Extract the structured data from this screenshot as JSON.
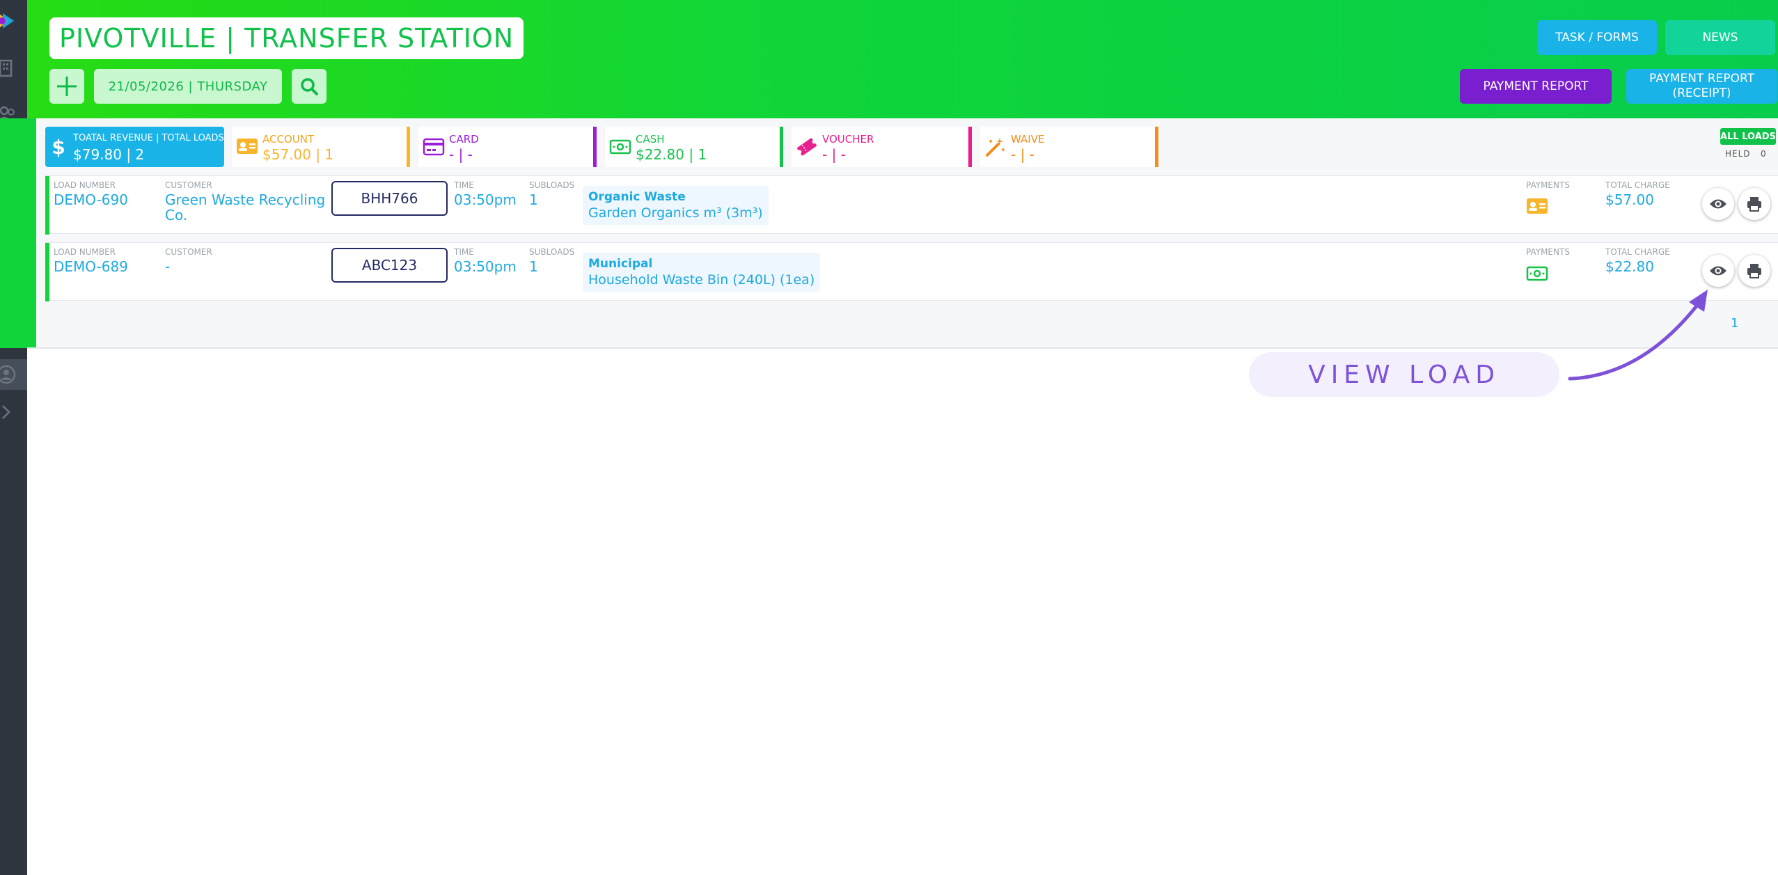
{
  "header": {
    "title": "PIVOTVILLE | TRANSFER STATION",
    "date": "21/05/2026 | THURSDAY",
    "buttons": {
      "task_forms": "TASK / FORMS",
      "news": "NEWS",
      "payment_report": "PAYMENT REPORT",
      "payment_report_receipt": "PAYMENT REPORT\n(RECEIPT)"
    }
  },
  "stats": {
    "total": {
      "label": "TOATAL REVENUE | TOTAL LOADS",
      "value": "$79.80 | 2"
    },
    "account": {
      "label": "ACCOUNT",
      "value": "$57.00 | 1"
    },
    "card": {
      "label": "CARD",
      "value": "- | -"
    },
    "cash": {
      "label": "CASH",
      "value": "$22.80 | 1"
    },
    "voucher": {
      "label": "VOUCHER",
      "value": "- | -"
    },
    "waive": {
      "label": "WAIVE",
      "value": "- | -"
    }
  },
  "filters": {
    "all_loads": "ALL LOADS",
    "held": "HELD",
    "held_count": "0"
  },
  "columns": {
    "load_number": "LOAD NUMBER",
    "customer": "CUSTOMER",
    "time": "TIME",
    "subloads": "SUBLOADS",
    "payments": "PAYMENTS",
    "total_charge": "TOTAL CHARGE"
  },
  "rows": [
    {
      "load_number": "DEMO-690",
      "customer_line1": "Green Waste Recycling",
      "customer_line2": "Co.",
      "plate": "BHH766",
      "time": "03:50pm",
      "subloads": "1",
      "material_type": "Organic Waste",
      "material_detail": "Garden Organics m³ (3m³)",
      "payment_icon": "account-card-icon",
      "total_charge": "$57.00"
    },
    {
      "load_number": "DEMO-689",
      "customer_line1": "-",
      "customer_line2": "",
      "plate": "ABC123",
      "time": "03:50pm",
      "subloads": "1",
      "material_type": "Municipal",
      "material_detail": "Household Waste Bin (240L) (1ea)",
      "payment_icon": "cash-icon",
      "total_charge": "$22.80"
    }
  ],
  "pagination": {
    "current": "1"
  },
  "callout": {
    "text": "VIEW LOAD"
  },
  "colors": {
    "header_green": "#0fd53a",
    "total_blue": "#1ab3e8",
    "account_orange": "#f7b52c",
    "card_purple": "#9b1fd8",
    "cash_green": "#16c24a",
    "voucher_pink": "#e8208f",
    "waive_orange": "#f58b1a",
    "report_purple": "#7a1fd0",
    "callout_purple": "#7d52d9"
  }
}
